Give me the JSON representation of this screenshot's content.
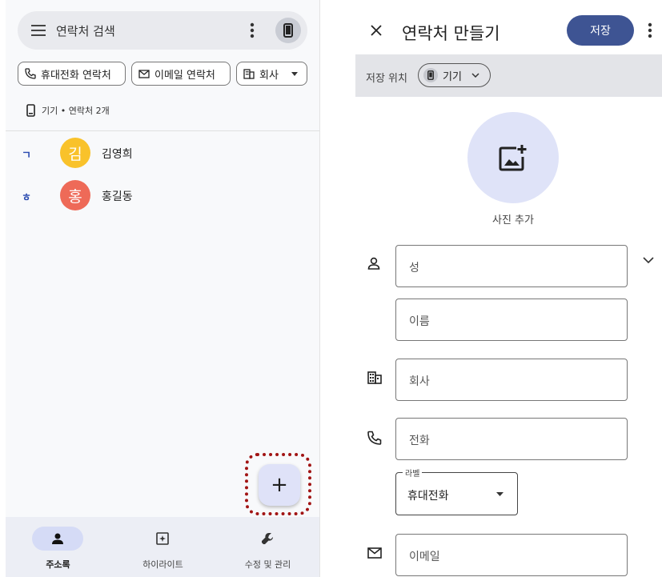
{
  "left": {
    "search": {
      "placeholder": "연락처 검색"
    },
    "chips": [
      {
        "label": "휴대전화 연락처"
      },
      {
        "label": "이메일 연락처"
      },
      {
        "label": "회사"
      }
    ],
    "device_info": "기기 • 연락처 2개",
    "contacts": [
      {
        "index": "ㄱ",
        "initial": "김",
        "name": "김영희",
        "color": "#f9c22b"
      },
      {
        "index": "ㅎ",
        "initial": "홍",
        "name": "홍길동",
        "color": "#ee6a58"
      }
    ],
    "fab": {
      "symbol": "+"
    },
    "bottom_nav": [
      {
        "label": "주소록",
        "icon": "person-icon",
        "active": true
      },
      {
        "label": "하이라이트",
        "icon": "highlight-icon",
        "active": false
      },
      {
        "label": "수정 및 관리",
        "icon": "wrench-icon",
        "active": false
      }
    ]
  },
  "right": {
    "title": "연락처 만들기",
    "save_label": "저장",
    "location": {
      "label": "저장 위치",
      "value": "기기"
    },
    "photo_label": "사진 추가",
    "fields": {
      "last_name": "성",
      "first_name": "이름",
      "company": "회사",
      "phone": "전화",
      "email": "이메일"
    },
    "phone_label": {
      "legend": "라벨",
      "value": "휴대전화"
    }
  },
  "colors": {
    "accent": "#3e5493",
    "fab_highlight": "#a11414",
    "photo_bg": "#dfe3f8"
  }
}
